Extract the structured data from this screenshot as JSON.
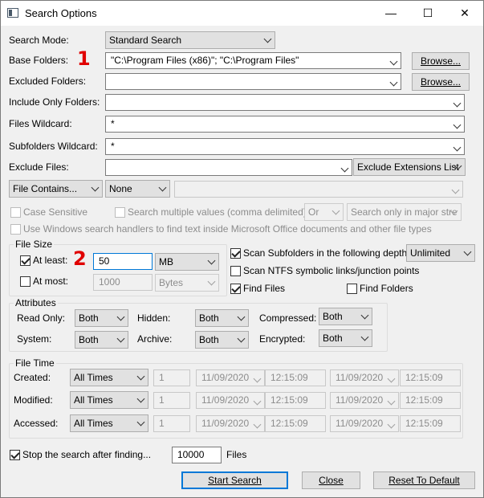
{
  "window": {
    "title": "Search Options",
    "minimize": "—",
    "maximize": "☐",
    "close": "✕"
  },
  "annotations": {
    "mark1": "1",
    "mark2": "2"
  },
  "search_mode": {
    "label": "Search Mode:",
    "value": "Standard Search"
  },
  "base_folders": {
    "label": "Base Folders:",
    "value": "\"C:\\Program Files (x86)\"; \"C:\\Program Files\"",
    "browse": "Browse..."
  },
  "excluded_folders": {
    "label": "Excluded Folders:",
    "value": "",
    "browse": "Browse..."
  },
  "include_only_folders": {
    "label": "Include Only Folders:",
    "value": ""
  },
  "files_wildcard": {
    "label": "Files Wildcard:",
    "value": "*"
  },
  "subfolders_wildcard": {
    "label": "Subfolders Wildcard:",
    "value": "*"
  },
  "exclude_files": {
    "label": "Exclude Files:",
    "value": "",
    "list_mode": "Exclude Extensions List"
  },
  "contains": {
    "mode": "File Contains...",
    "type": "None",
    "text": ""
  },
  "options": {
    "case_sensitive": "Case Sensitive",
    "multiple_values": "Search multiple values (comma delimited)",
    "or_value": "Or",
    "stream_value": "Search only in major stre",
    "windows_handlers": "Use Windows search handlers to find text inside Microsoft Office documents and other file types"
  },
  "file_size": {
    "title": "File Size",
    "at_least_label": "At least:",
    "at_least_value": "50",
    "at_least_unit": "MB",
    "at_most_label": "At most:",
    "at_most_value": "1000",
    "at_most_unit": "Bytes"
  },
  "scan": {
    "subfolders_label": "Scan Subfolders in the following depth:",
    "depth": "Unlimited",
    "ntfs_label": "Scan NTFS symbolic links/junction points",
    "find_files": "Find Files",
    "find_folders": "Find Folders"
  },
  "attributes": {
    "title": "Attributes",
    "read_only_label": "Read Only:",
    "read_only": "Both",
    "hidden_label": "Hidden:",
    "hidden": "Both",
    "compressed_label": "Compressed:",
    "compressed": "Both",
    "system_label": "System:",
    "system": "Both",
    "archive_label": "Archive:",
    "archive": "Both",
    "encrypted_label": "Encrypted:",
    "encrypted": "Both"
  },
  "file_time": {
    "title": "File Time",
    "rows": [
      {
        "label": "Created:",
        "mode": "All Times",
        "num": "1",
        "date1": "11/09/2020",
        "time1": "12:15:09",
        "date2": "11/09/2020",
        "time2": "12:15:09"
      },
      {
        "label": "Modified:",
        "mode": "All Times",
        "num": "1",
        "date1": "11/09/2020",
        "time1": "12:15:09",
        "date2": "11/09/2020",
        "time2": "12:15:09"
      },
      {
        "label": "Accessed:",
        "mode": "All Times",
        "num": "1",
        "date1": "11/09/2020",
        "time1": "12:15:09",
        "date2": "11/09/2020",
        "time2": "12:15:09"
      }
    ]
  },
  "stop": {
    "label": "Stop the search after finding...",
    "value": "10000",
    "unit": "Files"
  },
  "buttons": {
    "start": "Start Search",
    "close": "Close",
    "reset": "Reset To Default"
  }
}
